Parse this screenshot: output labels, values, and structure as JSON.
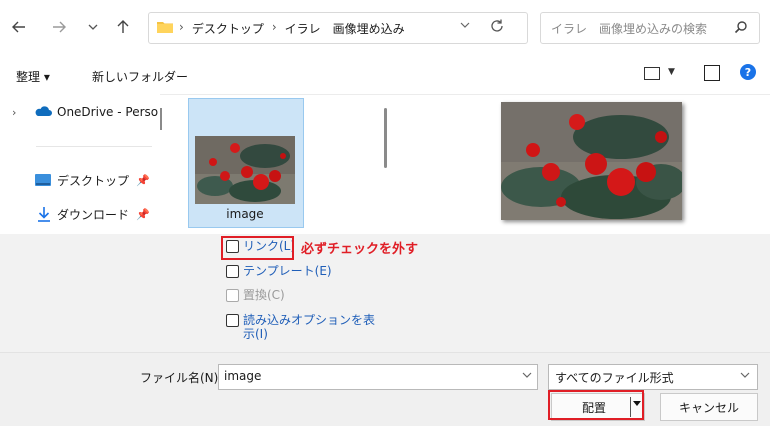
{
  "nav": {
    "back_icon": "arrow-left-icon",
    "forward_icon": "arrow-right-icon",
    "recent_icon": "chevron-down-icon",
    "up_icon": "arrow-up-icon"
  },
  "address": {
    "crumbs": [
      "デスクトップ",
      "イラレ　画像埋め込み"
    ],
    "separator": "›"
  },
  "search": {
    "placeholder": "イラレ　画像埋め込みの検索"
  },
  "toolbar": {
    "organize_label": "整理 ▾",
    "new_folder_label": "新しいフォルダー"
  },
  "sidebar": {
    "items": [
      {
        "label": "OneDrive - Perso",
        "icon": "onedrive-cloud-icon"
      },
      {
        "label": "デスクトップ",
        "icon": "desktop-icon",
        "pinned": true
      },
      {
        "label": "ダウンロード",
        "icon": "download-icon",
        "pinned": true
      }
    ]
  },
  "files": [
    {
      "name": "image",
      "selected": true
    }
  ],
  "options": {
    "link_label": "リンク(L)",
    "template_label": "テンプレート(E)",
    "replace_label": "置換(C)",
    "import_options_line1": "読み込みオプションを表",
    "import_options_line2": "示(I)",
    "annotation": "必ずチェックを外す"
  },
  "bottom": {
    "filename_label": "ファイル名(N):",
    "filename_value": "image",
    "filetype_value": "すべてのファイル形式",
    "place_label": "配置",
    "cancel_label": "キャンセル"
  },
  "colors": {
    "accent": "#1a73e8",
    "annotation_red": "#e01e26",
    "selection_bg": "#cce4f7",
    "option_link": "#1f5eb8"
  }
}
